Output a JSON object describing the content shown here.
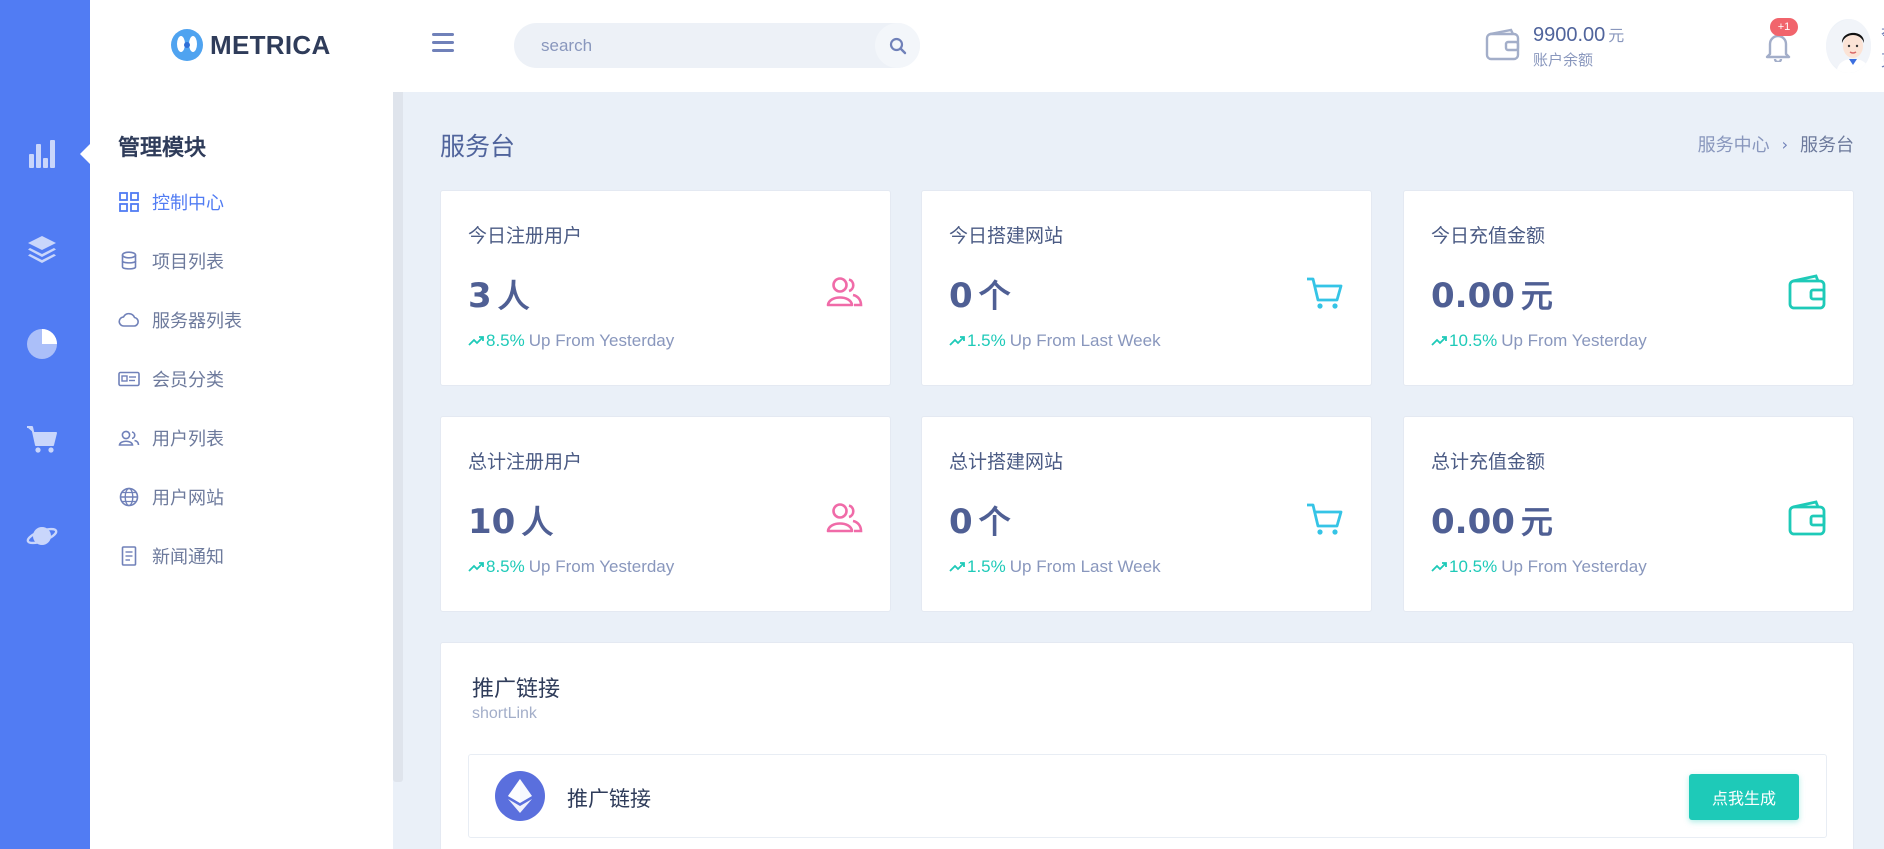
{
  "brand": {
    "name": "METRICA",
    "logo_icon": "metrica-logo-icon"
  },
  "colors": {
    "rail": "#517cf3",
    "accent": "#517cf3",
    "success": "#1ecab8",
    "pink": "#f06ba8",
    "cyan": "#35c4e6",
    "teal": "#1ecab8",
    "badge": "#f1646c"
  },
  "rail": {
    "items": [
      "bar-chart-icon",
      "layers-icon",
      "pie-chart-icon",
      "cart-icon",
      "planet-icon"
    ]
  },
  "header": {
    "search_placeholder": "search",
    "wallet": {
      "amount": "9900.00",
      "unit": "元",
      "label": "账户余额"
    },
    "notifications": {
      "badge": "+1"
    },
    "user": {
      "name": "夸克"
    }
  },
  "sidebar": {
    "title": "管理模块",
    "items": [
      {
        "label": "控制中心",
        "icon": "dashboard-grid-icon",
        "active": true
      },
      {
        "label": "项目列表",
        "icon": "database-icon"
      },
      {
        "label": "服务器列表",
        "icon": "cloud-icon"
      },
      {
        "label": "会员分类",
        "icon": "id-card-icon"
      },
      {
        "label": "用户列表",
        "icon": "users-icon"
      },
      {
        "label": "用户网站",
        "icon": "globe-icon"
      },
      {
        "label": "新闻通知",
        "icon": "document-icon"
      }
    ]
  },
  "page": {
    "title": "服务台",
    "breadcrumb": [
      "服务中心",
      "服务台"
    ]
  },
  "stats": [
    {
      "title": "今日注册用户",
      "value": "3",
      "unit": "人",
      "trend_pct": "8.5%",
      "trend_text": "Up From Yesterday",
      "icon": "users-icon"
    },
    {
      "title": "今日搭建网站",
      "value": "0",
      "unit": "个",
      "trend_pct": "1.5%",
      "trend_text": "Up From Last Week",
      "icon": "cart-icon"
    },
    {
      "title": "今日充值金额",
      "value": "0.00",
      "unit": "元",
      "trend_pct": "10.5%",
      "trend_text": "Up From Yesterday",
      "icon": "wallet-icon"
    },
    {
      "title": "总计注册用户",
      "value": "10",
      "unit": "人",
      "trend_pct": "8.5%",
      "trend_text": "Up From Yesterday",
      "icon": "users-icon"
    },
    {
      "title": "总计搭建网站",
      "value": "0",
      "unit": "个",
      "trend_pct": "1.5%",
      "trend_text": "Up From Last Week",
      "icon": "cart-icon"
    },
    {
      "title": "总计充值金额",
      "value": "0.00",
      "unit": "元",
      "trend_pct": "10.5%",
      "trend_text": "Up From Yesterday",
      "icon": "wallet-icon"
    }
  ],
  "promo": {
    "title": "推广链接",
    "subtitle": "shortLink",
    "row_label": "推广链接",
    "button_label": "点我生成"
  }
}
